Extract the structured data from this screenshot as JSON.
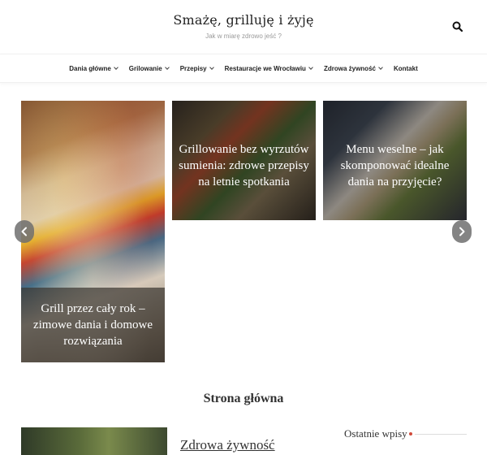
{
  "header": {
    "title": "Smażę, grilluję i żyję",
    "tagline": "Jak w miarę zdrowo jeść ?",
    "search_icon": "search-icon"
  },
  "nav": {
    "items": [
      {
        "label": "Dania główne",
        "has_dropdown": true
      },
      {
        "label": "Grilowanie",
        "has_dropdown": true
      },
      {
        "label": "Przepisy",
        "has_dropdown": true
      },
      {
        "label": "Restauracje we Wrocławiu",
        "has_dropdown": true
      },
      {
        "label": "Zdrowa żywność",
        "has_dropdown": true
      },
      {
        "label": "Kontakt",
        "has_dropdown": false
      }
    ]
  },
  "slider": {
    "slides": [
      {
        "caption": "Grill przez cały rok – zimowe dania i domowe rozwiązania"
      },
      {
        "caption": "Grillowanie bez wyrzutów sumienia: zdrowe przepisy na letnie spotkania"
      },
      {
        "caption": "Menu weselne – jak skomponować idealne dania na przyjęcie?"
      }
    ],
    "prev_icon": "chevron-left-icon",
    "next_icon": "chevron-right-icon"
  },
  "main": {
    "heading": "Strona główna",
    "post_category": "Zdrowa żywność"
  },
  "sidebar": {
    "title": "Ostatnie wpisy"
  },
  "colors": {
    "accent": "#d04a3a",
    "text": "#222222",
    "tagline": "#999999"
  }
}
